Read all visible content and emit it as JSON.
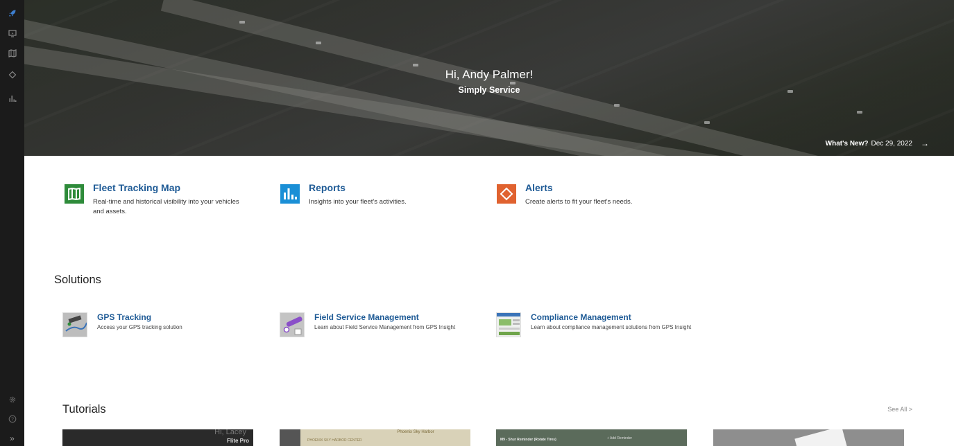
{
  "sidebar": {
    "items": [
      {
        "icon": "rocket-icon",
        "active": true
      },
      {
        "icon": "monitor-icon"
      },
      {
        "icon": "map-icon"
      },
      {
        "icon": "alert-tag-icon"
      },
      {
        "icon": "bar-chart-icon"
      }
    ],
    "bottom": [
      {
        "icon": "gear-icon"
      },
      {
        "icon": "help-icon"
      },
      {
        "icon": "expand-icon",
        "label": "»"
      }
    ]
  },
  "hero": {
    "greeting": "Hi, Andy Palmer!",
    "company": "Simply Service",
    "whats_new_label": "What's New?",
    "whats_new_date": "Dec 29, 2022",
    "arrow": "→"
  },
  "features": [
    {
      "title": "Fleet Tracking Map",
      "description": "Real-time and historical visibility into your vehicles and assets.",
      "icon": "map-icon",
      "color": "#2e8b3a"
    },
    {
      "title": "Reports",
      "description": "Insights into your fleet's activities.",
      "icon": "bar-chart-icon",
      "color": "#1a8fd6"
    },
    {
      "title": "Alerts",
      "description": "Create alerts to fit your fleet's needs.",
      "icon": "alert-tag-icon",
      "color": "#e0622f"
    }
  ],
  "solutions_title": "Solutions",
  "solutions": [
    {
      "title": "GPS Tracking",
      "description": "Access your GPS tracking solution"
    },
    {
      "title": "Field Service Management",
      "description": "Learn about Field Service Management from GPS Insight"
    },
    {
      "title": "Compliance Management",
      "description": "Learn about compliance management solutions from GPS Insight"
    }
  ],
  "tutorials_title": "Tutorials",
  "see_all": "See All >",
  "tutorial_snippets": [
    "Hi, Lacey",
    "Flite Pro",
    "Phoenix Sky Harbor",
    "PHOENIX SKY HARBOR CENTER",
    "M9 - Shur Reminder (Rotate Tires)",
    "+ Add Reminder"
  ]
}
